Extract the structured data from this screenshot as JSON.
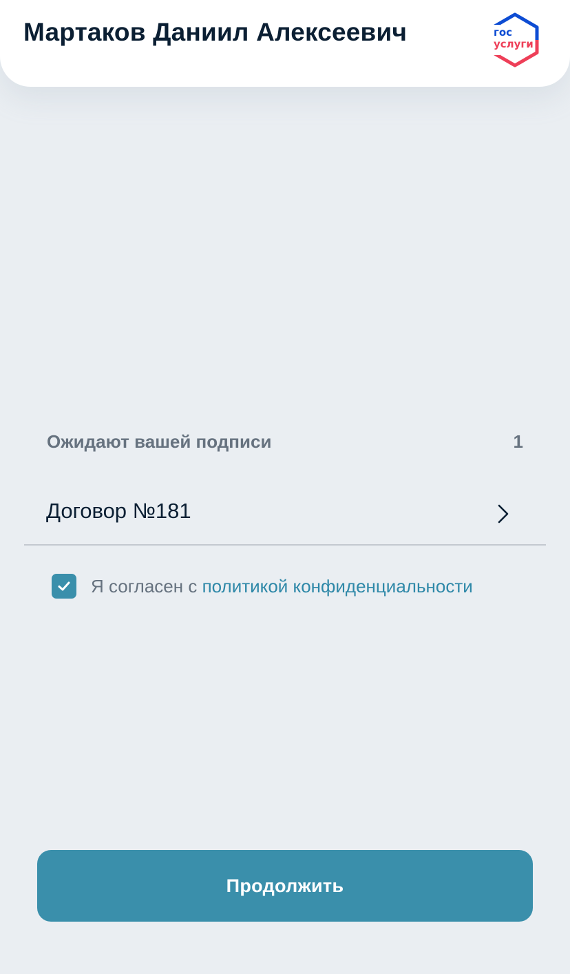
{
  "header": {
    "user_name": "Мартаков Даниил Алексеевич",
    "logo": {
      "line1": "гос",
      "line2": "услуги",
      "icon": "gosuslugi-logo-icon"
    }
  },
  "pending": {
    "label": "Ожидают вашей подписи",
    "count": "1"
  },
  "documents": [
    {
      "title": "Договор №181",
      "icon": "chevron-right-icon"
    }
  ],
  "agreement": {
    "checked": true,
    "prefix": "Я согласен с ",
    "link_text": "политикой конфиденциальности"
  },
  "actions": {
    "continue_label": "Продолжить"
  },
  "colors": {
    "background": "#eaeef2",
    "accent": "#3a8fab",
    "link": "#2e88a8",
    "text_primary": "#0b1f33",
    "text_secondary": "#66727f",
    "logo_blue": "#0d4cd3",
    "logo_red": "#ee3f58"
  }
}
